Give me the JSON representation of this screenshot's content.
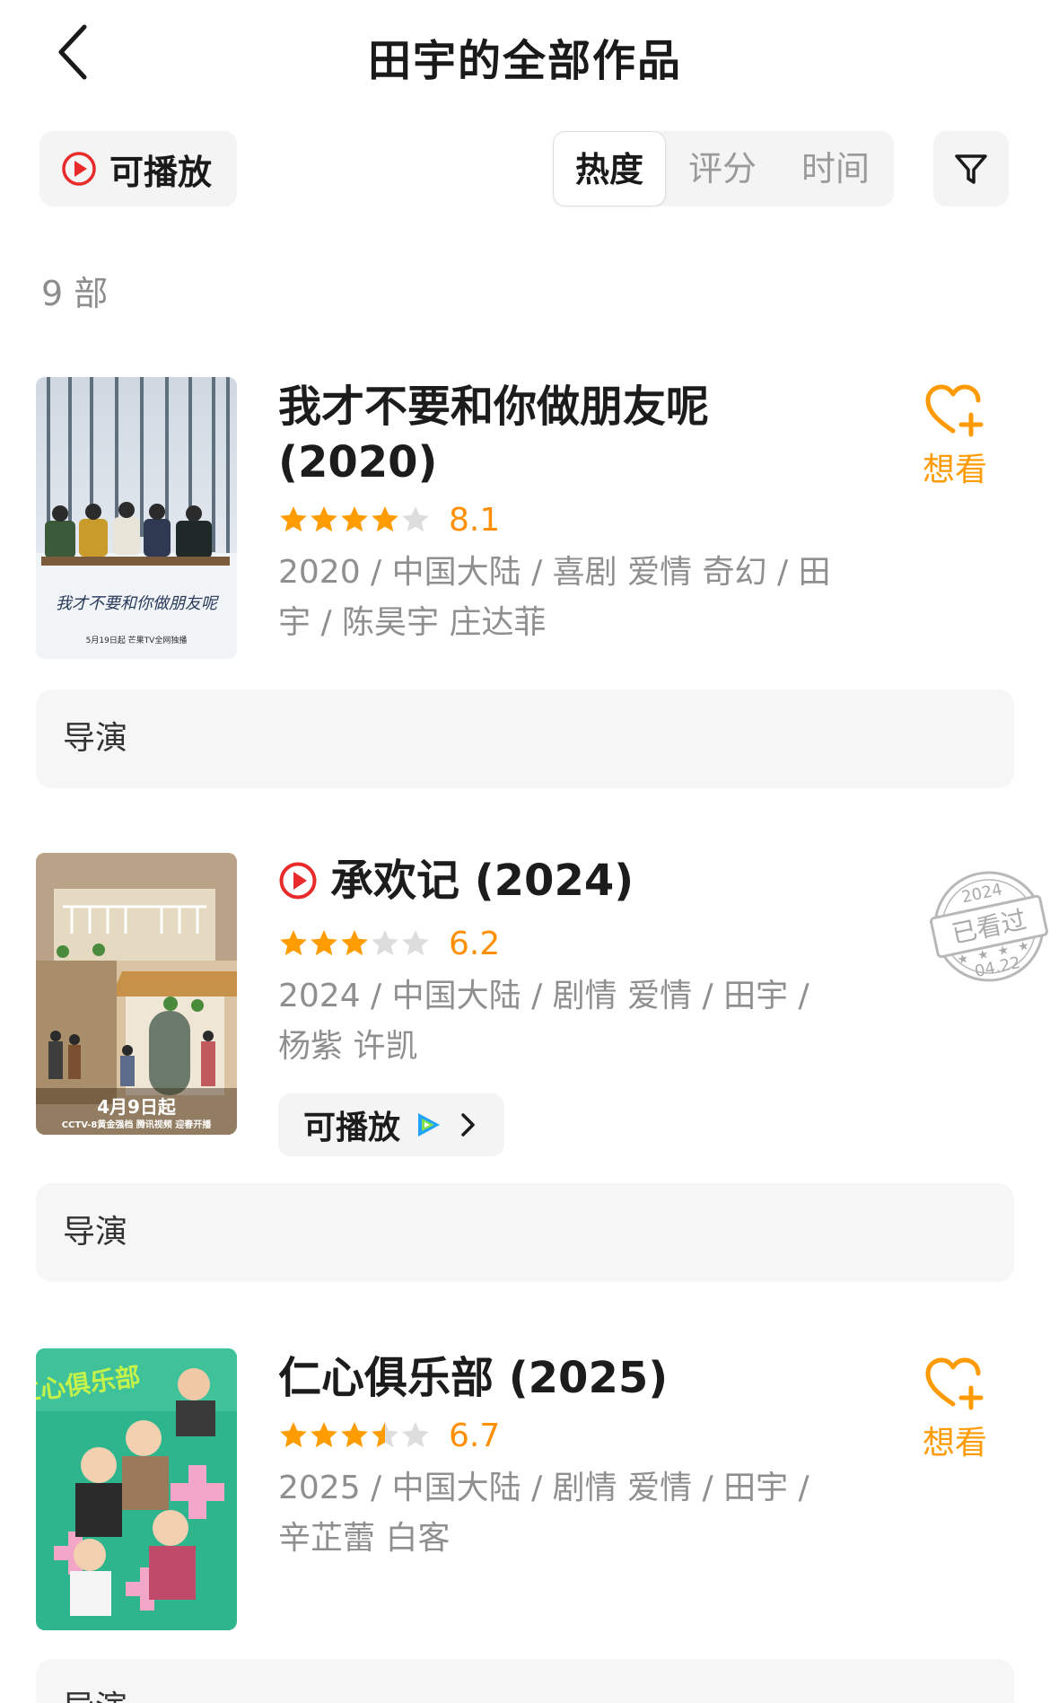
{
  "header": {
    "title": "田宇的全部作品"
  },
  "toolbar": {
    "playable_label": "可播放",
    "sort_tabs": [
      {
        "label": "热度",
        "active": true
      },
      {
        "label": "评分",
        "active": false
      },
      {
        "label": "时间",
        "active": false
      }
    ]
  },
  "count_text": "9 部",
  "colors": {
    "accent_orange": "#ff9a00",
    "star": "#ff9d00",
    "star_empty": "#dddddd",
    "play_red": "#e82a2a"
  },
  "works": [
    {
      "title_line1": "我才不要和你做朋友呢",
      "title_line2": "(2020)",
      "rating": 8.1,
      "rating_text": "8.1",
      "stars": 4,
      "meta_line1": "2020 / 中国大陆 / 喜剧 爱情 奇幻 / 田",
      "meta_line2": "宇 / 陈昊宇 庄达菲",
      "want_label": "想看",
      "director_label": "导演",
      "poster_text": "我才不要和你做朋友呢",
      "poster_caption": "5月19日起 芒果TV全网独播"
    },
    {
      "title": "承欢记 (2024)",
      "playable": true,
      "rating": 6.2,
      "rating_text": "6.2",
      "stars": 3,
      "meta_line1": "2024 / 中国大陆 / 剧情 爱情 / 田宇 /",
      "meta_line2": "杨紫 许凯",
      "play_label": "可播放",
      "director_label": "导演",
      "poster_date": "4月9日起",
      "poster_caption": "CCTV-8黄金强档 腾讯视频 迎春开播",
      "stamp": {
        "year": "2024",
        "text": "已看过",
        "date": "04.22"
      }
    },
    {
      "title": "仁心俱乐部 (2025)",
      "rating": 6.7,
      "rating_text": "6.7",
      "stars": 3.5,
      "meta_line1": "2025 / 中国大陆 / 剧情 爱情 / 田宇 /",
      "meta_line2": "辛芷蕾 白客",
      "want_label": "想看",
      "director_label": "导演",
      "poster_text": "仁心俱乐部"
    }
  ]
}
